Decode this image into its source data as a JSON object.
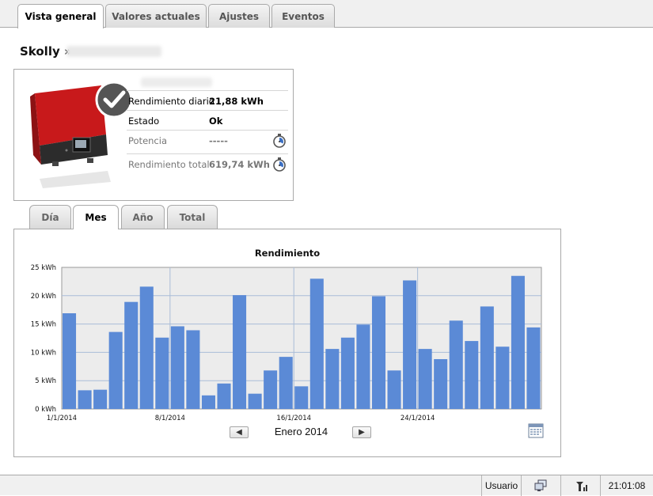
{
  "top_tabs": [
    {
      "label": "Vista general"
    },
    {
      "label": "Valores actuales"
    },
    {
      "label": "Ajustes"
    },
    {
      "label": "Eventos"
    }
  ],
  "page": {
    "title": "Skolly »"
  },
  "device": {
    "rows": [
      {
        "label": "Rendimiento diario",
        "value": "21,88  kWh"
      },
      {
        "label": "Estado",
        "value": "Ok"
      },
      {
        "label": "Potencia",
        "value": "-----"
      },
      {
        "label": "Rendimiento total",
        "value": "619,74  kWh"
      }
    ],
    "status_icon": "check-icon"
  },
  "sub_tabs": [
    {
      "label": "Día"
    },
    {
      "label": "Mes"
    },
    {
      "label": "Año"
    },
    {
      "label": "Total"
    }
  ],
  "chart_nav": {
    "prev_label": "<",
    "next_label": ">",
    "month": "Enero 2014",
    "calendar_icon": "calendar-icon"
  },
  "chart_data": {
    "type": "bar",
    "title": "Rendimiento",
    "ylabel": "",
    "xlabel": "",
    "ylim": [
      0,
      25
    ],
    "yticks": [
      "0 kWh",
      "5 kWh",
      "10 kWh",
      "15 kWh",
      "20 kWh",
      "25 kWh"
    ],
    "xtick_labels": [
      "1/1/2014",
      "8/1/2014",
      "16/1/2014",
      "24/1/2014"
    ],
    "xtick_days": [
      1,
      8,
      16,
      24
    ],
    "categories": [
      "1",
      "2",
      "3",
      "4",
      "5",
      "6",
      "7",
      "8",
      "9",
      "10",
      "11",
      "12",
      "13",
      "14",
      "15",
      "16",
      "17",
      "18",
      "19",
      "20",
      "21",
      "22",
      "23",
      "24",
      "25",
      "26",
      "27",
      "28",
      "29",
      "30",
      "31"
    ],
    "values": [
      16.9,
      3.3,
      3.4,
      13.6,
      18.9,
      21.6,
      12.6,
      14.6,
      13.9,
      2.4,
      4.5,
      20.1,
      2.7,
      6.8,
      9.2,
      4.0,
      23.0,
      10.6,
      12.6,
      14.9,
      19.9,
      6.8,
      22.7,
      10.6,
      8.8,
      15.6,
      12.0,
      18.1,
      11.0,
      23.5,
      14.4
    ],
    "grid": true,
    "bar_color": "#5b8ad6"
  },
  "statusbar": {
    "user": "Usuario",
    "time": "21:01:08",
    "network_icon": "network-icon",
    "signal_icon": "signal-icon"
  }
}
